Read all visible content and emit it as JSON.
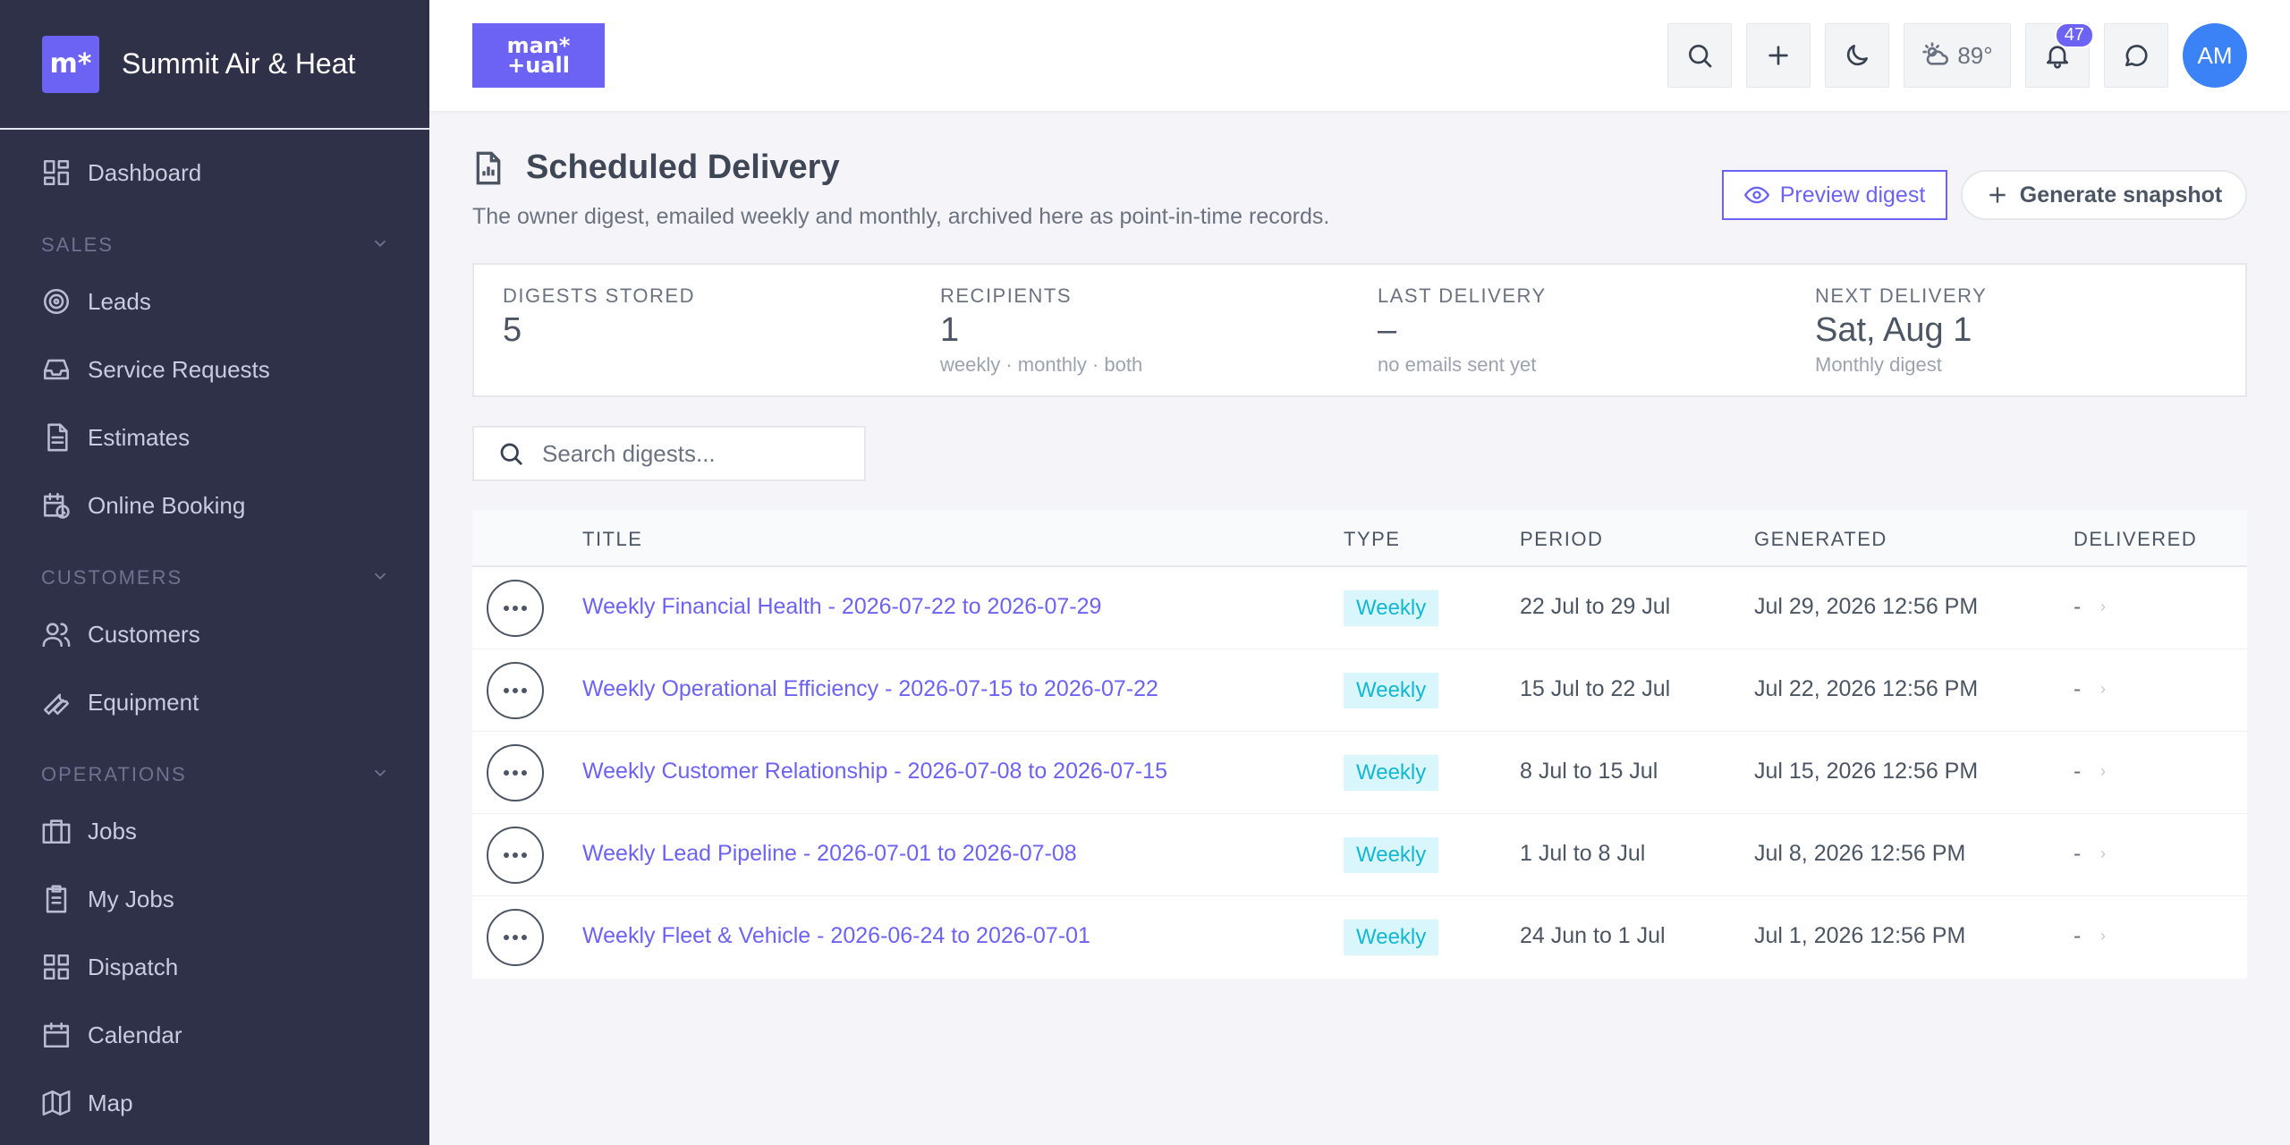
{
  "sidebar": {
    "brand_logo": "m*",
    "brand_name": "Summit Air & Heat",
    "dashboard": "Dashboard",
    "sections": {
      "sales": "SALES",
      "customers": "CUSTOMERS",
      "operations": "OPERATIONS"
    },
    "sales_items": [
      "Leads",
      "Service Requests",
      "Estimates",
      "Online Booking"
    ],
    "customer_items": [
      "Customers",
      "Equipment"
    ],
    "operation_items": [
      "Jobs",
      "My Jobs",
      "Dispatch",
      "Calendar",
      "Map"
    ]
  },
  "topbar": {
    "logo_line1": "man*",
    "logo_line2": "+uall",
    "weather": "89°",
    "notifications_count": "47",
    "avatar_initials": "AM"
  },
  "page": {
    "title": "Scheduled Delivery",
    "subtitle": "The owner digest, emailed weekly and monthly, archived here as point-in-time records.",
    "preview_label": "Preview digest",
    "generate_label": "Generate snapshot"
  },
  "stats": [
    {
      "label": "DIGESTS STORED",
      "value": "5",
      "note": ""
    },
    {
      "label": "RECIPIENTS",
      "value": "1",
      "note": "weekly · monthly · both"
    },
    {
      "label": "LAST DELIVERY",
      "value": "–",
      "note": "no emails sent yet"
    },
    {
      "label": "NEXT DELIVERY",
      "value": "Sat, Aug 1",
      "note": "Monthly digest"
    }
  ],
  "search": {
    "placeholder": "Search digests..."
  },
  "table": {
    "headers": {
      "title": "TITLE",
      "type": "TYPE",
      "period": "PERIOD",
      "generated": "GENERATED",
      "delivered": "DELIVERED"
    },
    "rows": [
      {
        "title": "Weekly Financial Health - 2026-07-22 to 2026-07-29",
        "type": "Weekly",
        "period": "22 Jul to 29 Jul",
        "generated": "Jul 29, 2026 12:56 PM",
        "delivered": "-"
      },
      {
        "title": "Weekly Operational Efficiency - 2026-07-15 to 2026-07-22",
        "type": "Weekly",
        "period": "15 Jul to 22 Jul",
        "generated": "Jul 22, 2026 12:56 PM",
        "delivered": "-"
      },
      {
        "title": "Weekly Customer Relationship - 2026-07-08 to 2026-07-15",
        "type": "Weekly",
        "period": "8 Jul to 15 Jul",
        "generated": "Jul 15, 2026 12:56 PM",
        "delivered": "-"
      },
      {
        "title": "Weekly Lead Pipeline - 2026-07-01 to 2026-07-08",
        "type": "Weekly",
        "period": "1 Jul to 8 Jul",
        "generated": "Jul 8, 2026 12:56 PM",
        "delivered": "-"
      },
      {
        "title": "Weekly Fleet & Vehicle - 2026-06-24 to 2026-07-01",
        "type": "Weekly",
        "period": "24 Jun to 1 Jul",
        "generated": "Jul 1, 2026 12:56 PM",
        "delivered": "-"
      }
    ]
  }
}
